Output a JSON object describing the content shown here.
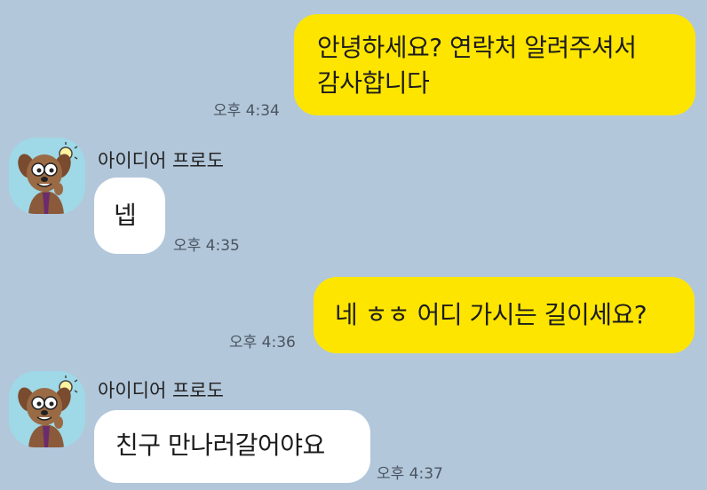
{
  "contact": {
    "name": "아이디어 프로도",
    "avatar_icon": "frodo-dog-lightbulb-avatar"
  },
  "colors": {
    "background": "#b2c7da",
    "my_bubble": "#fee500",
    "their_bubble": "#ffffff"
  },
  "messages": [
    {
      "sender": "me",
      "lines": [
        "안녕하세요? 연락처 알려주셔서",
        "감사합니다"
      ],
      "time": "오후 4:34"
    },
    {
      "sender": "them",
      "sender_name": "아이디어 프로도",
      "lines": [
        "넵"
      ],
      "time": "오후 4:35"
    },
    {
      "sender": "me",
      "lines": [
        "네 ㅎㅎ 어디 가시는 길이세요?"
      ],
      "time": "오후 4:36"
    },
    {
      "sender": "them",
      "sender_name": "아이디어 프로도",
      "lines": [
        "친구 만나러갈어야요"
      ],
      "time": "오후 4:37"
    }
  ]
}
